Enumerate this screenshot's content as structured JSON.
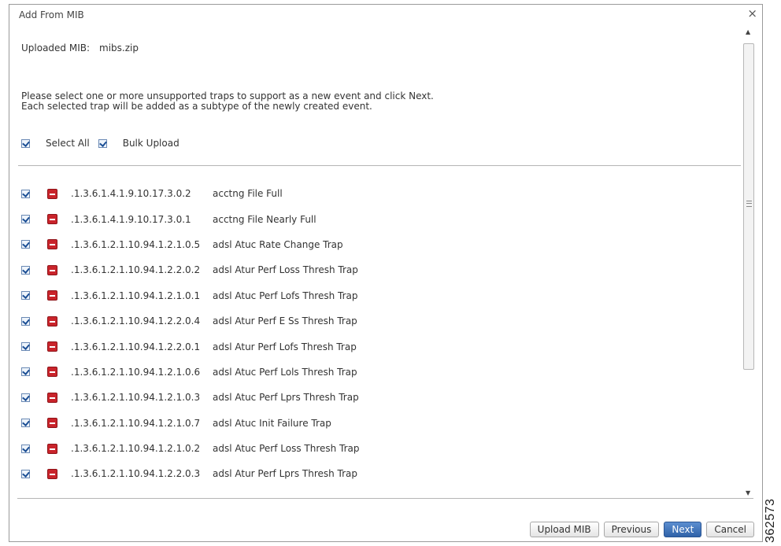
{
  "dialog": {
    "title": "Add From MIB",
    "close_label": "×"
  },
  "uploaded": {
    "label": "Uploaded MIB:",
    "value": "mibs.zip"
  },
  "instructions": {
    "line1": "Please select one or more unsupported traps to support as a new event and click Next.",
    "line2": "Each selected trap will be added as a subtype of the newly created event."
  },
  "options": {
    "select_all_label": "Select All",
    "select_all_checked": true,
    "bulk_upload_label": "Bulk Upload",
    "bulk_upload_checked": true
  },
  "traps": [
    {
      "oid": ".1.3.6.1.4.1.9.10.17.3.0.2",
      "name": "acctng File Full",
      "checked": true,
      "severity": "critical"
    },
    {
      "oid": ".1.3.6.1.4.1.9.10.17.3.0.1",
      "name": "acctng File Nearly Full",
      "checked": true,
      "severity": "critical"
    },
    {
      "oid": ".1.3.6.1.2.1.10.94.1.2.1.0.5",
      "name": "adsl Atuc Rate Change Trap",
      "checked": true,
      "severity": "critical"
    },
    {
      "oid": ".1.3.6.1.2.1.10.94.1.2.2.0.2",
      "name": "adsl Atur Perf Loss Thresh Trap",
      "checked": true,
      "severity": "critical"
    },
    {
      "oid": ".1.3.6.1.2.1.10.94.1.2.1.0.1",
      "name": "adsl Atuc Perf Lofs Thresh Trap",
      "checked": true,
      "severity": "critical"
    },
    {
      "oid": ".1.3.6.1.2.1.10.94.1.2.2.0.4",
      "name": "adsl Atur Perf E Ss Thresh Trap",
      "checked": true,
      "severity": "critical"
    },
    {
      "oid": ".1.3.6.1.2.1.10.94.1.2.2.0.1",
      "name": "adsl Atur Perf Lofs Thresh Trap",
      "checked": true,
      "severity": "critical"
    },
    {
      "oid": ".1.3.6.1.2.1.10.94.1.2.1.0.6",
      "name": "adsl Atuc Perf Lols Thresh Trap",
      "checked": true,
      "severity": "critical"
    },
    {
      "oid": ".1.3.6.1.2.1.10.94.1.2.1.0.3",
      "name": "adsl Atuc Perf Lprs Thresh Trap",
      "checked": true,
      "severity": "critical"
    },
    {
      "oid": ".1.3.6.1.2.1.10.94.1.2.1.0.7",
      "name": "adsl Atuc Init Failure Trap",
      "checked": true,
      "severity": "critical"
    },
    {
      "oid": ".1.3.6.1.2.1.10.94.1.2.1.0.2",
      "name": "adsl Atuc Perf Loss Thresh Trap",
      "checked": true,
      "severity": "critical"
    },
    {
      "oid": ".1.3.6.1.2.1.10.94.1.2.2.0.3",
      "name": "adsl Atur Perf Lprs Thresh Trap",
      "checked": true,
      "severity": "critical"
    }
  ],
  "buttons": {
    "upload_mib": "Upload MIB",
    "previous": "Previous",
    "next": "Next",
    "cancel": "Cancel"
  },
  "figure_id": "362573",
  "colors": {
    "primary_button": "#2f62a8",
    "severity_critical": "#c9242b",
    "checkbox_border": "#6a89b4"
  }
}
